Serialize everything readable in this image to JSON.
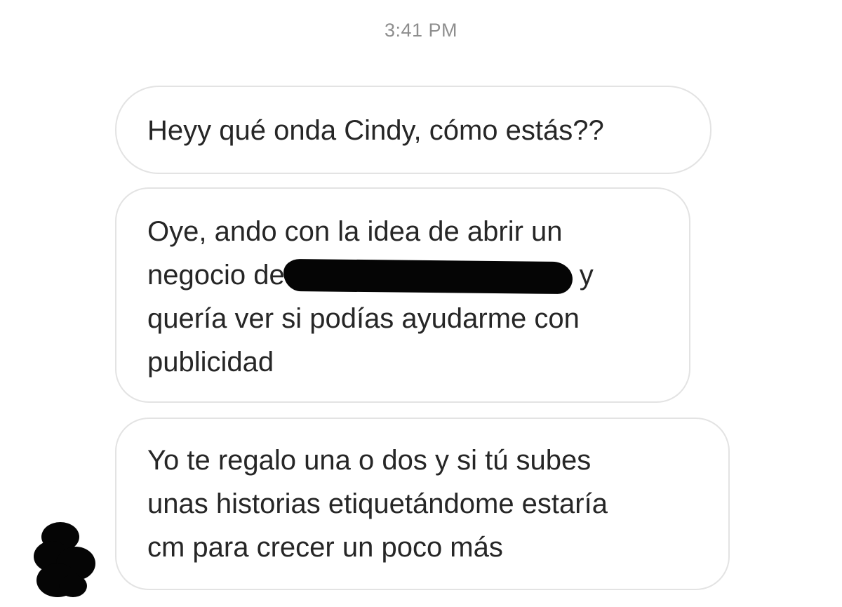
{
  "conversation": {
    "timestamp": "3:41 PM",
    "messages": [
      {
        "lines": [
          "Heyy qué onda Cindy, cómo estás??"
        ]
      },
      {
        "lines": [
          "Oye, ando con la idea de abrir un",
          "negocio de",
          "y",
          "quería ver si podías ayudarme con",
          "publicidad"
        ]
      },
      {
        "lines": [
          "Yo te regalo una o dos y si tú subes",
          "unas historias etiquetándome estaría",
          "cm para crecer un poco más"
        ]
      }
    ]
  },
  "colors": {
    "bubble_border": "#e3e3e3",
    "text": "#262626",
    "timestamp": "#8e8e8e",
    "redaction": "#050505"
  },
  "icons": {
    "avatar": "sender-avatar-redacted"
  }
}
